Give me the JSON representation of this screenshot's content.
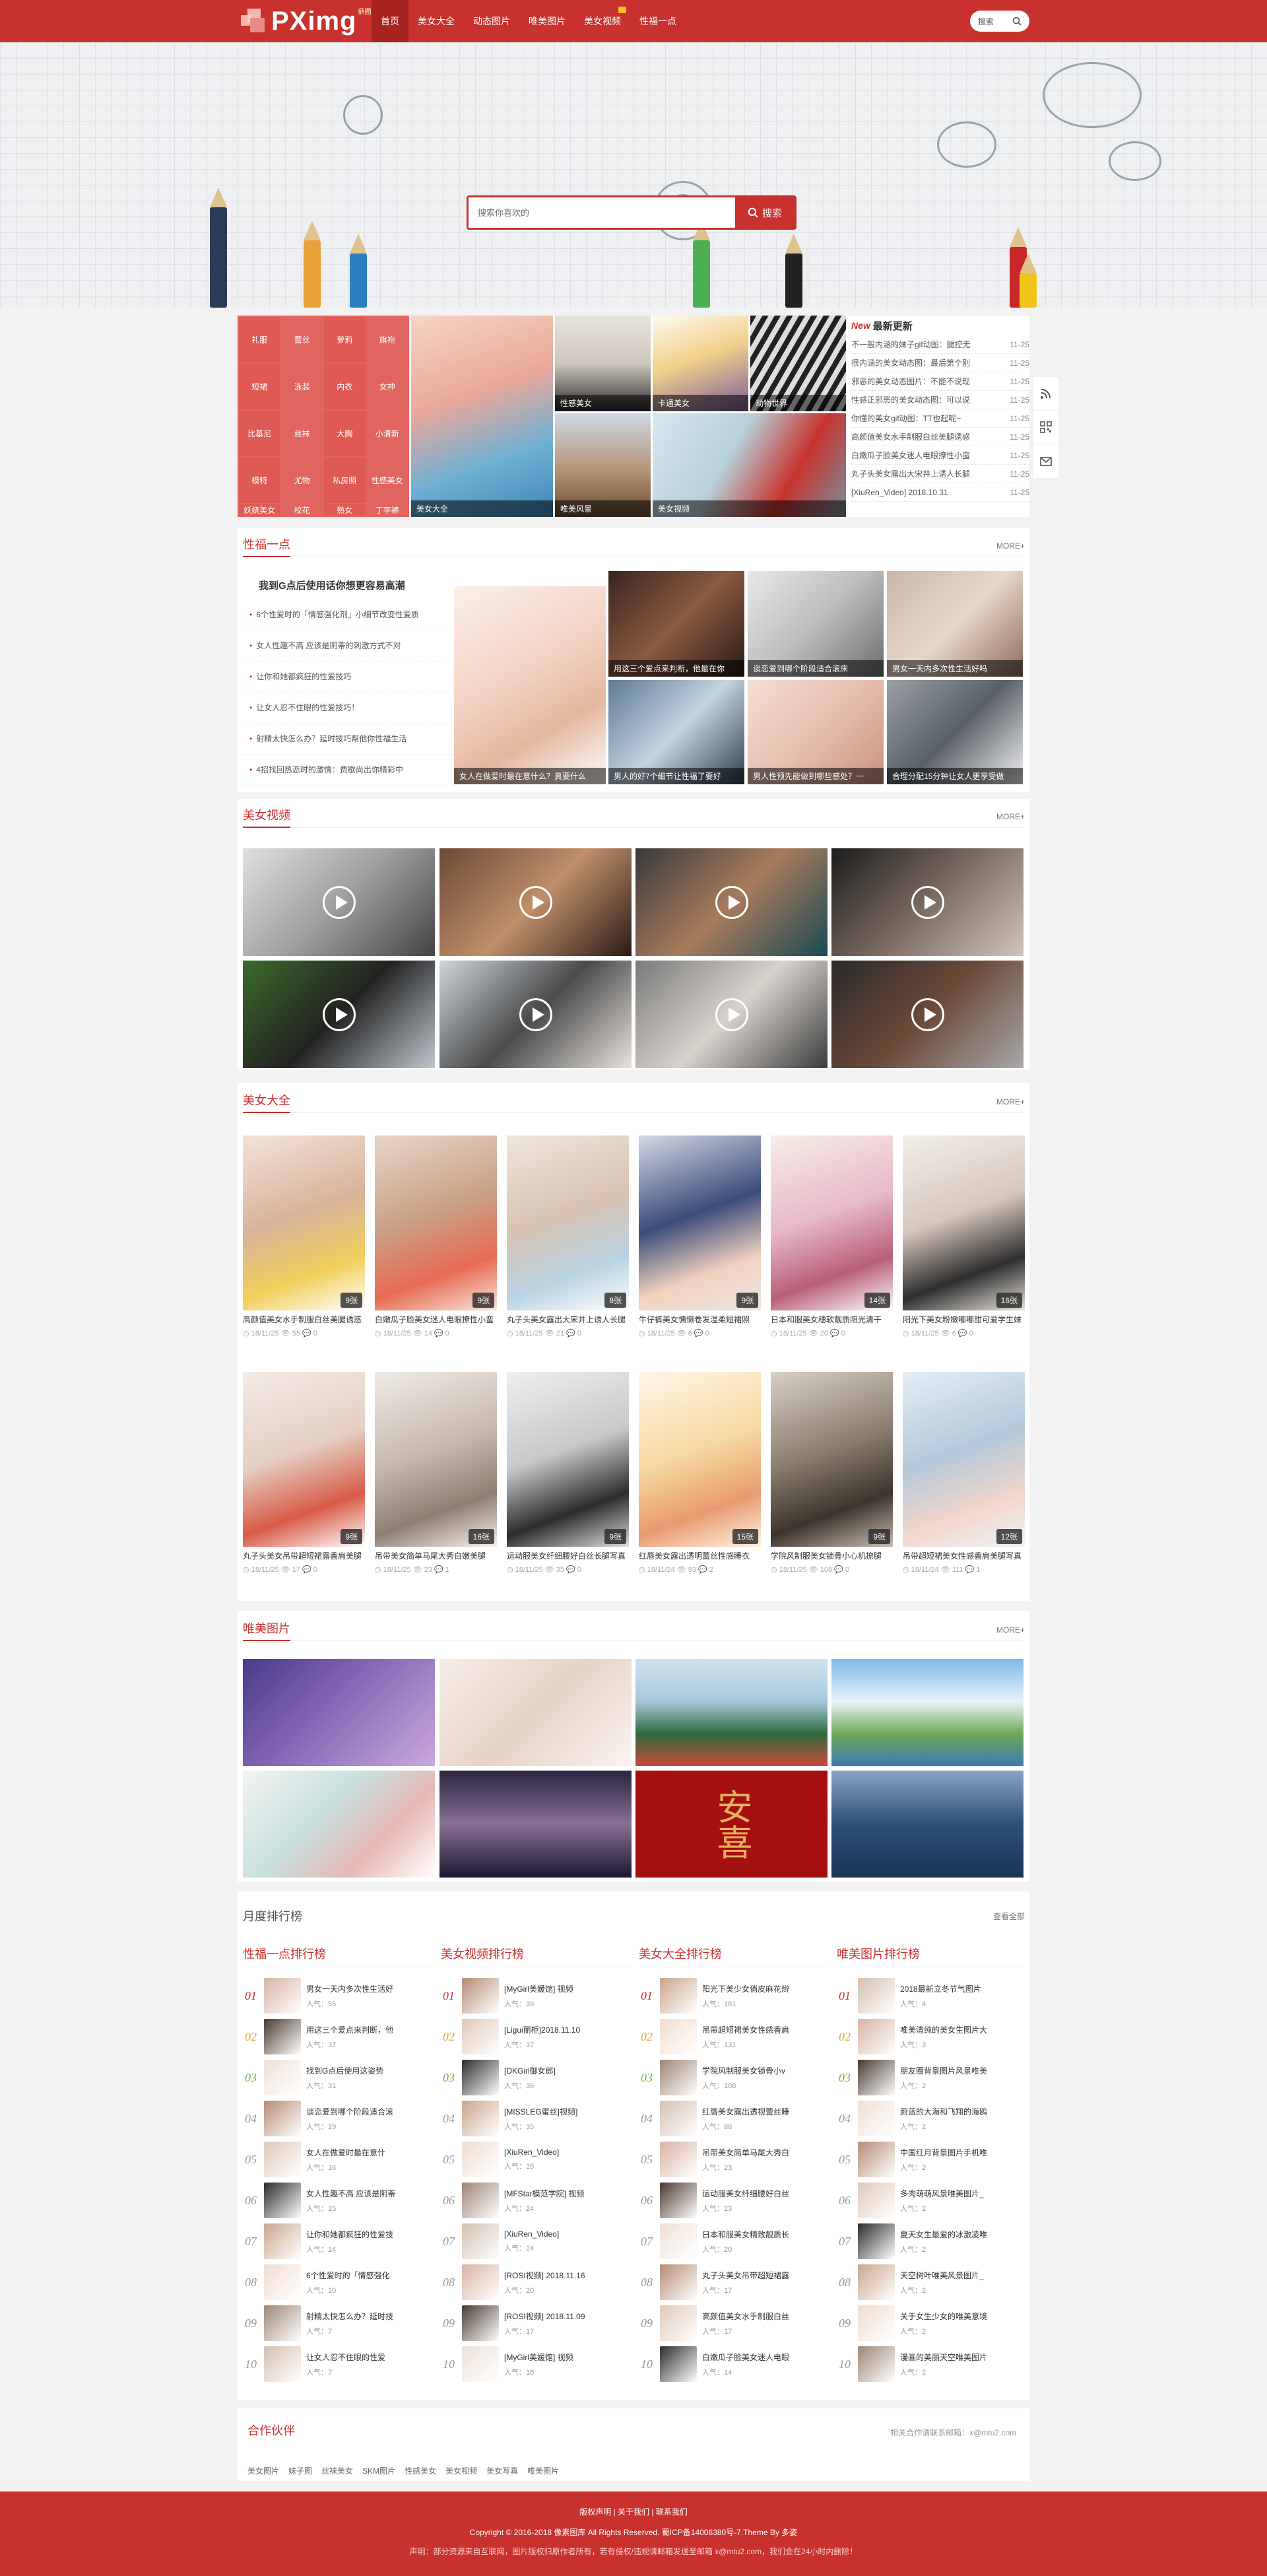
{
  "header": {
    "logo": "PXimg",
    "logo_sup": "鼎图网",
    "nav": [
      {
        "label": "首页",
        "active": true
      },
      {
        "label": "美女大全",
        "active": false
      },
      {
        "label": "动态图片",
        "active": false
      },
      {
        "label": "唯美图片",
        "active": false
      },
      {
        "label": "美女视频",
        "active": false,
        "new": true
      },
      {
        "label": "性福一点",
        "active": false
      }
    ],
    "search_label": "搜索"
  },
  "hero": {
    "search_placeholder": "搜索你喜欢的",
    "search_button": "搜索"
  },
  "tags": [
    "礼服",
    "蕾丝",
    "萝莉",
    "旗袍",
    "短裙",
    "泳装",
    "内衣",
    "女神",
    "比基尼",
    "丝袜",
    "大胸",
    "小清新",
    "模特",
    "尤物",
    "私房照",
    "性感美女",
    "妖娆美女",
    "校花",
    "熟女",
    "丁字裤"
  ],
  "featured": [
    {
      "caption": "美女大全"
    },
    {
      "caption": "性感美女"
    },
    {
      "caption": "卡通美女"
    },
    {
      "caption": "动物世界"
    },
    {
      "caption": "唯美风景"
    },
    {
      "caption": "美女视频"
    }
  ],
  "news": {
    "new_tag": "New",
    "title": "最新更新",
    "items": [
      {
        "text": "不一般内涵的妹子gif动图：腿控无",
        "date": "11-25"
      },
      {
        "text": "很内涵的美女动态图：最后第个别",
        "date": "11-25"
      },
      {
        "text": "邪恶的美女动态图片：不能不说现",
        "date": "11-25"
      },
      {
        "text": "性感正邪恶的美女动态图：可以说",
        "date": "11-25"
      },
      {
        "text": "你懂的美女gif动图：TT也起呢~",
        "date": "11-25"
      },
      {
        "text": "高颜值美女水手制服白丝美腿诱惑",
        "date": "11-25"
      },
      {
        "text": "白嫩瓜子脸美女迷人电眼撩性小蛮",
        "date": "11-25"
      },
      {
        "text": "丸子头美女露出大宋井上诱人长腿",
        "date": "11-25"
      },
      {
        "text": "[XiuRen_Video] 2018.10.31",
        "date": "11-25"
      }
    ]
  },
  "float_icons": [
    "rss-icon",
    "qrcode-icon",
    "mail-icon"
  ],
  "romance": {
    "title": "性福一点",
    "more": "MORE+",
    "headline": "我到G点后使用话你想更容易高潮",
    "list": [
      "6个性爱时的「情感强化剂」小细节改变性爱质",
      "女人性趣不高 应该是阴蒂的刺激方式不对",
      "让你和她都疯狂的性爱技巧",
      "让女人忍不住眼的性爱技巧！",
      "射精太快怎么办？延时技巧帮他你性福生活",
      "4招找回热恋时的激情：费歇尚出你精彩中"
    ],
    "big_caption": "女人在做爱时最在意什么？真要什么",
    "grid_captions": [
      "用这三个爱点来判断，他最在你",
      "谈恋爱到哪个阶段适合滚床",
      "男女一天内多次性生活好吗",
      "男人的好7个细节让性福了要好",
      "男人性预先能做到哪些感处？一",
      "合理分配15分钟让女人更享受做"
    ]
  },
  "videos": {
    "title": "美女视频",
    "more": "MORE+"
  },
  "gallery": {
    "title": "美女大全",
    "more": "MORE+",
    "items": [
      {
        "title": "高颜值美女水手制服白丝美腿诱惑",
        "count": "9张",
        "date": "18/11/25",
        "views": "55",
        "comments": "0"
      },
      {
        "title": "白嫩瓜子脸美女迷人电眼撩性小蛮",
        "count": "9张",
        "date": "18/11/25",
        "views": "14",
        "comments": "0"
      },
      {
        "title": "丸子头美女露出大宋井上诱人长腿",
        "count": "8张",
        "date": "18/11/25",
        "views": "21",
        "comments": "0"
      },
      {
        "title": "牛仔裤美女慵懒卷发温柔短裙照",
        "count": "9张",
        "date": "18/11/25",
        "views": "6",
        "comments": "0"
      },
      {
        "title": "日本和服美女穗软靓质阳光清干",
        "count": "14张",
        "date": "18/11/25",
        "views": "20",
        "comments": "0"
      },
      {
        "title": "阳光下美女粉嫩嘟嘟甜可爱学生妹",
        "count": "16张",
        "date": "18/11/25",
        "views": "6",
        "comments": "0"
      },
      {
        "title": "丸子头美女吊带超短裙露香肩美腿",
        "count": "9张",
        "date": "18/11/25",
        "views": "17",
        "comments": "0"
      },
      {
        "title": "吊带美女简单马尾大秀白嫩美腿",
        "count": "16张",
        "date": "18/11/25",
        "views": "23",
        "comments": "1"
      },
      {
        "title": "运动服美女纤细腰好白丝长腿写真",
        "count": "9张",
        "date": "18/11/25",
        "views": "35",
        "comments": "0"
      },
      {
        "title": "红唇美女露出透明蕾丝性感睡衣",
        "count": "15张",
        "date": "18/11/24",
        "views": "93",
        "comments": "2"
      },
      {
        "title": "学院风制服美女锁骨小心机撩腿",
        "count": "9张",
        "date": "18/11/25",
        "views": "108",
        "comments": "0"
      },
      {
        "title": "吊带超短裙美女性感香肩美腿写真",
        "count": "12张",
        "date": "18/11/24",
        "views": "111",
        "comments": "1"
      }
    ]
  },
  "beauty": {
    "title": "唯美图片",
    "more": "MORE+",
    "anzhi_text": "安喜"
  },
  "ranking": {
    "title": "月度排行榜",
    "all": "查看全部",
    "columns": [
      {
        "title": "性福一点排行榜",
        "items": [
          {
            "t": "男女一天内多次性生活好",
            "v": "人气：55"
          },
          {
            "t": "用这三个爱点来判断，他",
            "v": "人气：37"
          },
          {
            "t": "找到G点后使用这姿势",
            "v": "人气：31"
          },
          {
            "t": "谈恋爱到哪个阶段适合滚",
            "v": "人气：19"
          },
          {
            "t": "女人在做爱时最在意什",
            "v": "人气：16"
          },
          {
            "t": "女人性趣不高 应该是阴蒂",
            "v": "人气：15"
          },
          {
            "t": "让你和她都疯狂的性爱技",
            "v": "人气：14"
          },
          {
            "t": "6个性爱时的「情感强化",
            "v": "人气：10"
          },
          {
            "t": "射精太快怎么办？延时技",
            "v": "人气：7"
          },
          {
            "t": "让女人忍不住眼的性爱",
            "v": "人气：7"
          }
        ]
      },
      {
        "title": "美女视频排行榜",
        "items": [
          {
            "t": "[MyGirl美媛馆] 视频",
            "v": "人气：39"
          },
          {
            "t": "[Ligui丽柜]2018.11.10",
            "v": "人气：37"
          },
          {
            "t": "[DKGirl御女郎]",
            "v": "人气：36"
          },
          {
            "t": "[MISSLEG蜜丝]视频]",
            "v": "人气：35"
          },
          {
            "t": "[XiuRen_Video]",
            "v": "人气：25"
          },
          {
            "t": "[MFStar模范学院] 视频",
            "v": "人气：24"
          },
          {
            "t": "[XiuRen_Video]",
            "v": "人气：24"
          },
          {
            "t": "[ROSI视频] 2018.11.16",
            "v": "人气：20"
          },
          {
            "t": "[ROSI视频] 2018.11.09",
            "v": "人气：17"
          },
          {
            "t": "[MyGirl美媛馆] 视频",
            "v": "人气：16"
          }
        ]
      },
      {
        "title": "美女大全排行榜",
        "items": [
          {
            "t": "阳光下美少女俏皮麻花辫",
            "v": "人气：181"
          },
          {
            "t": "吊带超短裙美女性感香肩",
            "v": "人气：131"
          },
          {
            "t": "学院风制服美女锁骨小v",
            "v": "人气：108"
          },
          {
            "t": "红唇美女露出透视蕾丝睡",
            "v": "人气：88"
          },
          {
            "t": "吊带美女简单马尾大秀白",
            "v": "人气：23"
          },
          {
            "t": "运动服美女纤细腰好白丝",
            "v": "人气：23"
          },
          {
            "t": "日本和服美女精致靓质长",
            "v": "人气：20"
          },
          {
            "t": "丸子头美女吊带超短裙露",
            "v": "人气：17"
          },
          {
            "t": "高颜值美女水手制服白丝",
            "v": "人气：17"
          },
          {
            "t": "白嫩瓜子脸美女迷人电眼",
            "v": "人气：14"
          }
        ]
      },
      {
        "title": "唯美图片排行榜",
        "items": [
          {
            "t": "2018最新立冬节气图片",
            "v": "人气：4"
          },
          {
            "t": "唯美清纯的美女生图片大",
            "v": "人气：3"
          },
          {
            "t": "朋友圈背景图片风景唯美",
            "v": "人气：2"
          },
          {
            "t": "蔚蓝的大海和飞翔的海鸥",
            "v": "人气：2"
          },
          {
            "t": "中国红月背景图片手机唯",
            "v": "人气：2"
          },
          {
            "t": "多肉萌萌风景唯美图片_",
            "v": "人气：2"
          },
          {
            "t": "夏天女生最爱的冰激凌唯",
            "v": "人气：2"
          },
          {
            "t": "天空树叶唯美风景图片_",
            "v": "人气：2"
          },
          {
            "t": "关于女生少女的唯美意境",
            "v": "人气：2"
          },
          {
            "t": "漫画的美丽天空唯美图片",
            "v": "人气：2"
          }
        ]
      }
    ]
  },
  "partner": {
    "title": "合作伙伴",
    "contact": "相关合作请联系邮箱：x@mtu2.com",
    "links": [
      "美女图片",
      "妹子图",
      "丝袜美女",
      "SKM图片",
      "性感美女",
      "美女视频",
      "美女写真",
      "唯美图片"
    ]
  },
  "footer": {
    "links": "版权声明 | 关于我们 | 联系我们",
    "copy": "Copyright © 2016-2018 像素图库 All Rights Reserved. 蜀ICP备14006380号-7.Theme By 多姿",
    "notice": "声明：部分资源来自互联网，图片版权归原作者所有，若有侵权/违规请邮箱发送至邮箱 x@mtu2.com，我们会在24小时内删除！"
  },
  "colors": {
    "accent": "#c8312d",
    "tag_bg": "#e06460"
  }
}
